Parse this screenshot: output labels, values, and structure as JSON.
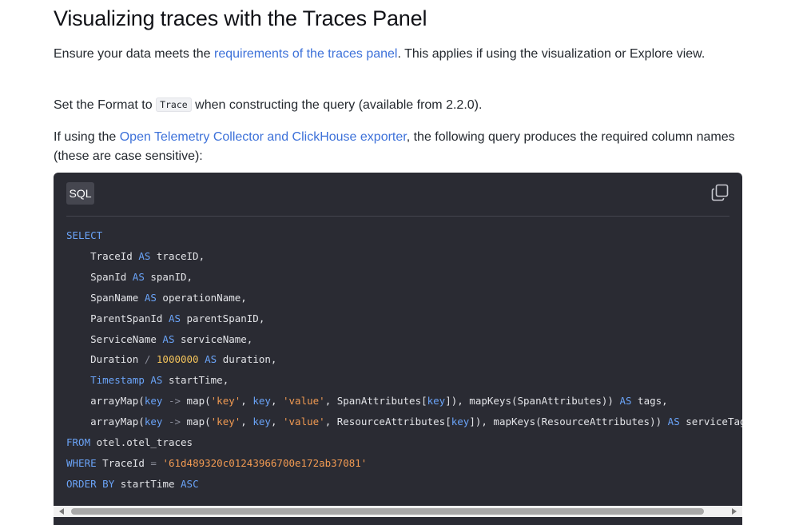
{
  "heading": "Visualizing traces with the Traces Panel",
  "para1": {
    "before": "Ensure your data meets the ",
    "link": "requirements of the traces panel",
    "after": ". This applies if using the visualization or Explore view."
  },
  "para2": {
    "before": "Set the Format to ",
    "code": "Trace",
    "after": " when constructing the query (available from 2.2.0)."
  },
  "para3": {
    "before": "If using the ",
    "link": "Open Telemetry Collector and ClickHouse exporter",
    "after": ", the following query produces the required column names (these are case sensitive):"
  },
  "code_block": {
    "language": "SQL",
    "copy_icon": "copy-icon",
    "lines": [
      [
        [
          "kw",
          "SELECT"
        ]
      ],
      [
        [
          "t",
          "    TraceId "
        ],
        [
          "kw",
          "AS"
        ],
        [
          "t",
          " traceID,"
        ]
      ],
      [
        [
          "t",
          "    SpanId "
        ],
        [
          "kw",
          "AS"
        ],
        [
          "t",
          " spanID,"
        ]
      ],
      [
        [
          "t",
          "    SpanName "
        ],
        [
          "kw",
          "AS"
        ],
        [
          "t",
          " operationName,"
        ]
      ],
      [
        [
          "t",
          "    ParentSpanId "
        ],
        [
          "kw",
          "AS"
        ],
        [
          "t",
          " parentSpanID,"
        ]
      ],
      [
        [
          "t",
          "    ServiceName "
        ],
        [
          "kw",
          "AS"
        ],
        [
          "t",
          " serviceName,"
        ]
      ],
      [
        [
          "t",
          "    Duration "
        ],
        [
          "op",
          "/"
        ],
        [
          "t",
          " "
        ],
        [
          "num",
          "1000000"
        ],
        [
          "t",
          " "
        ],
        [
          "kw",
          "AS"
        ],
        [
          "t",
          " duration,"
        ]
      ],
      [
        [
          "t",
          "    "
        ],
        [
          "kw",
          "Timestamp"
        ],
        [
          "t",
          " "
        ],
        [
          "kw",
          "AS"
        ],
        [
          "t",
          " startTime,"
        ]
      ],
      [
        [
          "t",
          "    arrayMap("
        ],
        [
          "kw",
          "key"
        ],
        [
          "t",
          " "
        ],
        [
          "op",
          "->"
        ],
        [
          "t",
          " map("
        ],
        [
          "str",
          "'key'"
        ],
        [
          "t",
          ", "
        ],
        [
          "kw",
          "key"
        ],
        [
          "t",
          ", "
        ],
        [
          "str",
          "'value'"
        ],
        [
          "t",
          ", SpanAttributes["
        ],
        [
          "kw",
          "key"
        ],
        [
          "t",
          "]), mapKeys(SpanAttributes)) "
        ],
        [
          "kw",
          "AS"
        ],
        [
          "t",
          " tags,"
        ]
      ],
      [
        [
          "t",
          "    arrayMap("
        ],
        [
          "kw",
          "key"
        ],
        [
          "t",
          " "
        ],
        [
          "op",
          "->"
        ],
        [
          "t",
          " map("
        ],
        [
          "str",
          "'key'"
        ],
        [
          "t",
          ", "
        ],
        [
          "kw",
          "key"
        ],
        [
          "t",
          ", "
        ],
        [
          "str",
          "'value'"
        ],
        [
          "t",
          ", ResourceAttributes["
        ],
        [
          "kw",
          "key"
        ],
        [
          "t",
          "]), mapKeys(ResourceAttributes)) "
        ],
        [
          "kw",
          "AS"
        ],
        [
          "t",
          " serviceTags"
        ]
      ],
      [
        [
          "kw",
          "FROM"
        ],
        [
          "t",
          " otel.otel_traces"
        ]
      ],
      [
        [
          "kw",
          "WHERE"
        ],
        [
          "t",
          " TraceId "
        ],
        [
          "op",
          "="
        ],
        [
          "t",
          " "
        ],
        [
          "str",
          "'61d489320c01243966700e172ab37081'"
        ]
      ],
      [
        [
          "kw",
          "ORDER"
        ],
        [
          "t",
          " "
        ],
        [
          "kw",
          "BY"
        ],
        [
          "t",
          " startTime "
        ],
        [
          "kw",
          "ASC"
        ]
      ]
    ]
  },
  "scrollbar": {
    "left_arrow": "scroll-left-arrow-icon",
    "right_arrow": "scroll-right-arrow-icon"
  }
}
